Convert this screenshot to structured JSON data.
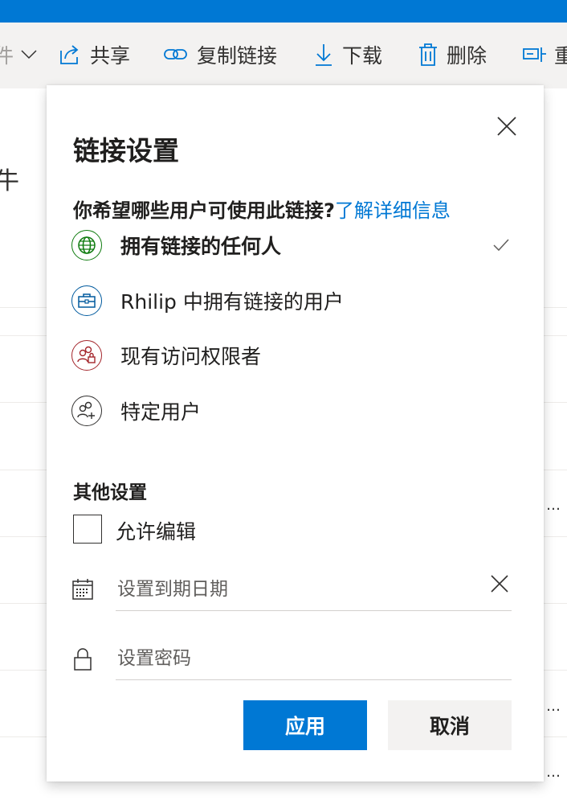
{
  "toolbar": {
    "frag_label": "件",
    "share_label": "共享",
    "copy_link_label": "复制链接",
    "download_label": "下载",
    "delete_label": "删除",
    "more_label": "重"
  },
  "background": {
    "files_fragment": "牛",
    "ellipsis": "…"
  },
  "dialog": {
    "title": "链接设置",
    "question": "你希望哪些用户可使用此链接?",
    "learn_more": "了解详细信息",
    "options": [
      {
        "label": "拥有链接的任何人",
        "icon": "globe-icon",
        "color": "#107c10",
        "selected": true
      },
      {
        "label": "Rhilip 中拥有链接的用户",
        "icon": "briefcase-icon",
        "color": "#005a9e",
        "selected": false
      },
      {
        "label": "现有访问权限者",
        "icon": "people-lock-icon",
        "color": "#a4262c",
        "selected": false
      },
      {
        "label": "特定用户",
        "icon": "people-add-icon",
        "color": "#323130",
        "selected": false
      }
    ],
    "other_settings": "其他设置",
    "allow_edit": "允许编辑",
    "expiry_placeholder": "设置到期日期",
    "password_placeholder": "设置密码",
    "apply_label": "应用",
    "cancel_label": "取消"
  },
  "colors": {
    "accent": "#0078d4",
    "topbar": "#0078d4"
  }
}
